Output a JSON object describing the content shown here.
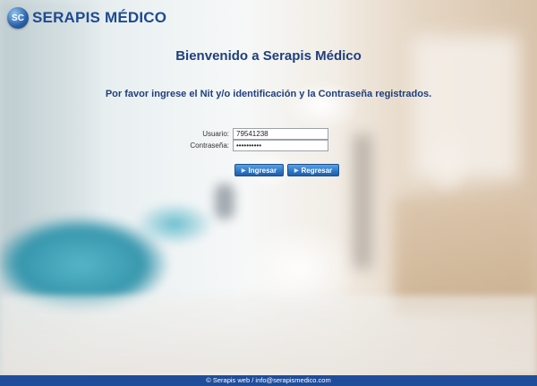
{
  "brand": {
    "logo_initials": "SC",
    "name": "SERAPIS MÉDICO",
    "color": "#1e4a90"
  },
  "header": {
    "title": "Bienvenido a Serapis Médico",
    "instructions": "Por favor ingrese el Nit y/o identificación y la Contraseña registrados."
  },
  "form": {
    "username_label": "Usuario:",
    "username_value": "79541238",
    "password_label": "Contraseña:",
    "password_value": "••••••••••"
  },
  "buttons": {
    "login_label": "Ingresar",
    "back_label": "Regresar",
    "arrow_icon": "play-arrow-icon",
    "color": "#2f79c8"
  },
  "footer": {
    "text": "© Serapis web / info@serapismedico.com",
    "color": "#1f4d9a"
  }
}
